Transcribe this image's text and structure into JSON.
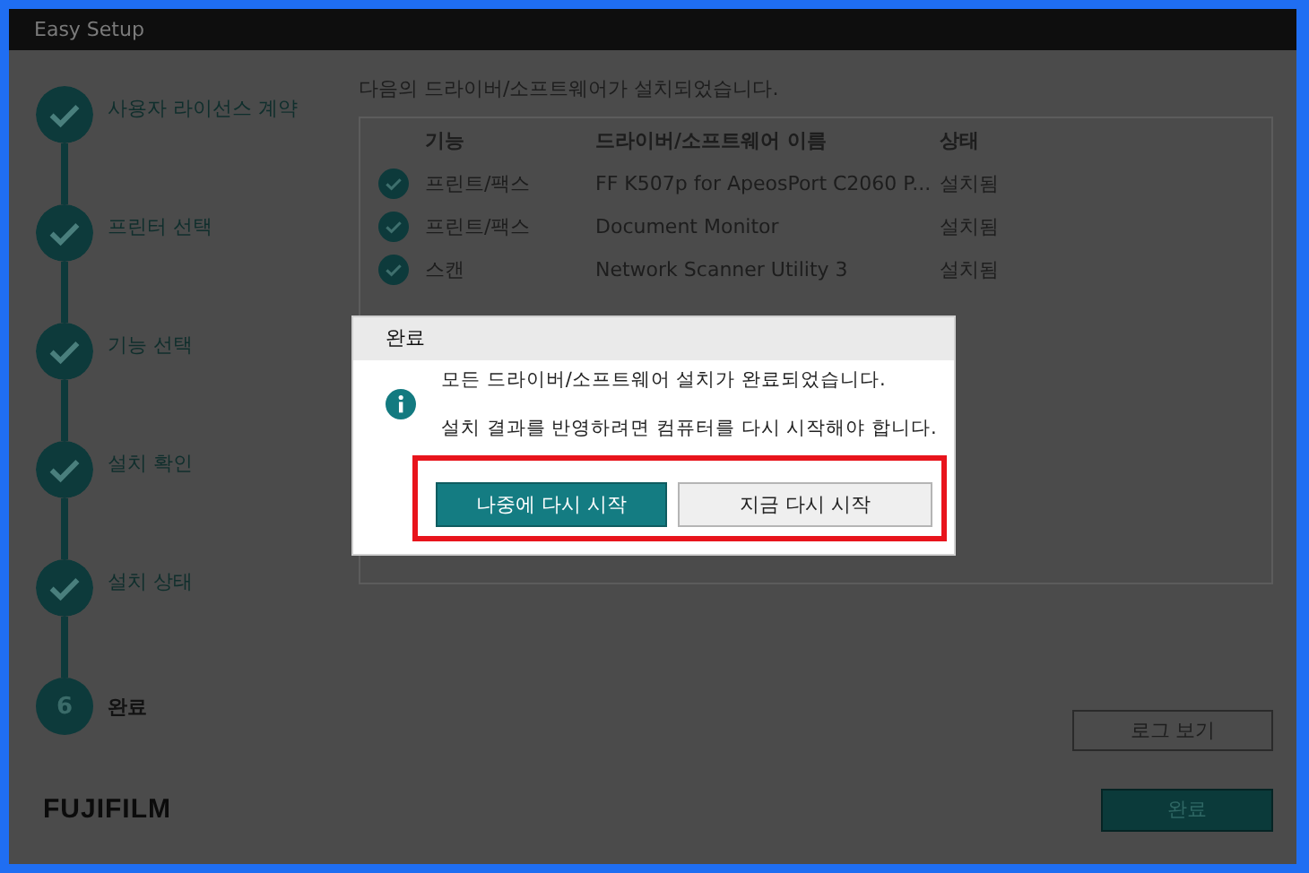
{
  "window": {
    "title": "Easy Setup"
  },
  "steps": [
    {
      "label": "사용자 라이선스 계약",
      "done": true
    },
    {
      "label": "프린터 선택",
      "done": true
    },
    {
      "label": "기능 선택",
      "done": true
    },
    {
      "label": "설치 확인",
      "done": true
    },
    {
      "label": "설치 상태",
      "done": true
    },
    {
      "label": "완료",
      "done": false,
      "number": "6"
    }
  ],
  "message": "다음의 드라이버/소프트웨어가 설치되었습니다.",
  "table": {
    "columns": [
      "기능",
      "드라이버/소프트웨어 이름",
      "상태"
    ],
    "rows": [
      {
        "installed": true,
        "cells": [
          "프린트/팩스",
          "FF K507p for ApeosPort C2060 P...",
          "설치됨"
        ]
      },
      {
        "installed": true,
        "cells": [
          "프린트/팩스",
          "Document Monitor",
          "설치됨"
        ]
      },
      {
        "installed": true,
        "cells": [
          "스캔",
          "Network Scanner Utility 3",
          "설치됨"
        ]
      }
    ]
  },
  "log_button": "로그 보기",
  "logo": "FUJIFILM",
  "finish_button": "완료",
  "dialog": {
    "title": "완료",
    "lines": [
      "모든 드라이버/소프트웨어 설치가 완료되었습니다.",
      "설치 결과를 반영하려면 컴퓨터를 다시 시작해야 합니다."
    ],
    "buttons_highlighted": true,
    "buttons": [
      {
        "label": "나중에 다시 시작",
        "primary": true
      },
      {
        "label": "지금 다시 시작",
        "primary": false
      }
    ]
  }
}
